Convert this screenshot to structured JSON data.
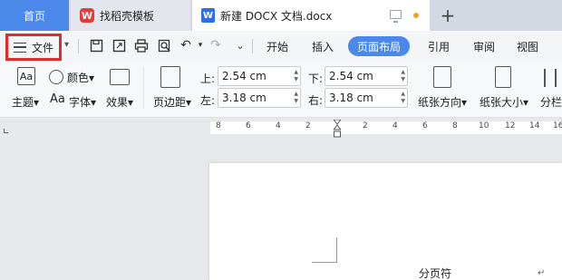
{
  "tabs": {
    "home": "首页",
    "template": "找稻壳模板",
    "document": "新建 DOCX 文档.docx",
    "template_logo": "W",
    "doc_logo": "W",
    "add": "+"
  },
  "toolbar": {
    "file": "文件",
    "nav": [
      "开始",
      "插入",
      "页面布局",
      "引用",
      "审阅",
      "视图"
    ]
  },
  "ribbon": {
    "theme": "主题",
    "colors": "颜色",
    "fonts": "字体",
    "effects": "效果",
    "margins": "页边距",
    "top_label": "上:",
    "top_value": "2.54 cm",
    "bottom_label": "下:",
    "bottom_value": "2.54 cm",
    "left_label": "左:",
    "left_value": "3.18 cm",
    "right_label": "右:",
    "right_value": "3.18 cm",
    "orientation": "纸张方向",
    "size": "纸张大小",
    "columns": "分栏"
  },
  "ruler": [
    "8",
    "6",
    "4",
    "2",
    "2",
    "4",
    "6",
    "8",
    "10",
    "12",
    "14",
    "16",
    "18"
  ],
  "document": {
    "page_break_text": "分页符"
  },
  "colors": {
    "accent": "#4a88ea",
    "highlight_box": "#e12b2b"
  }
}
